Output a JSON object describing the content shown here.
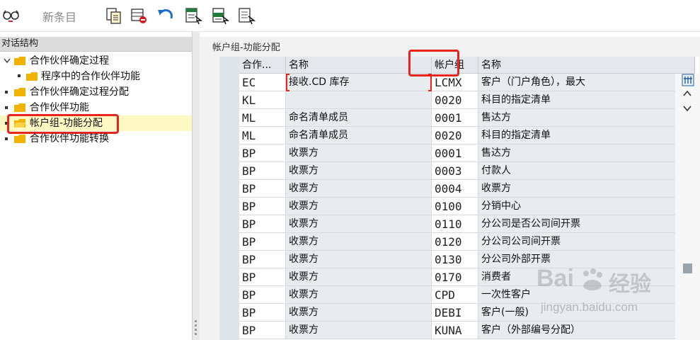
{
  "toolbar": {
    "new_entries_label": "新条目",
    "icons": [
      "glasses-icon",
      "copy-icon",
      "delete-icon",
      "undo-icon",
      "select-all-icon",
      "select-block-icon",
      "deselect-icon"
    ]
  },
  "tree": {
    "header": "对话结构",
    "items": [
      {
        "label": "合作伙伴确定过程"
      },
      {
        "label": "程序中的合作伙伴功能"
      },
      {
        "label": "合作伙伴确定过程分配"
      },
      {
        "label": "合作伙伴功能"
      },
      {
        "label": "帐户组-功能分配"
      },
      {
        "label": "合作伙伴功能转换"
      }
    ]
  },
  "panel": {
    "title": "帐户组-功能分配"
  },
  "table": {
    "columns": [
      "合作...",
      "名称",
      "帐户组",
      "名称"
    ],
    "rows": [
      [
        "EC",
        "接收.CD 库存",
        "LCMX",
        "客户（门户角色），最大"
      ],
      [
        "KL",
        "",
        "0020",
        "科目的指定清单"
      ],
      [
        "ML",
        "命名清单成员",
        "0001",
        "售达方"
      ],
      [
        "ML",
        "命名清单成员",
        "0020",
        "科目的指定清单"
      ],
      [
        "BP",
        "收票方",
        "0001",
        "售达方"
      ],
      [
        "BP",
        "收票方",
        "0003",
        "付款人"
      ],
      [
        "BP",
        "收票方",
        "0004",
        "收票方"
      ],
      [
        "BP",
        "收票方",
        "0100",
        "分销中心"
      ],
      [
        "BP",
        "收票方",
        "0110",
        "分公司是否公司间开票"
      ],
      [
        "BP",
        "收票方",
        "0120",
        "分公司公司间开票"
      ],
      [
        "BP",
        "收票方",
        "0130",
        "分公司外部开票"
      ],
      [
        "BP",
        "收票方",
        "0170",
        "消费者"
      ],
      [
        "BP",
        "收票方",
        "CPD",
        "一次性客户"
      ],
      [
        "BP",
        "收票方",
        "DEBI",
        "客户(一般)"
      ],
      [
        "BP",
        "收票方",
        "KUNA",
        "客户（外部编号分配）"
      ]
    ]
  },
  "watermark": {
    "brand": "Bai",
    "brand_suffix": "经验",
    "url": "jingyan.baidu.com"
  },
  "colors": {
    "highlight_red": "#e8251c",
    "folder_yellow": "#f0b400",
    "selection_yellow": "#fff9c4"
  }
}
